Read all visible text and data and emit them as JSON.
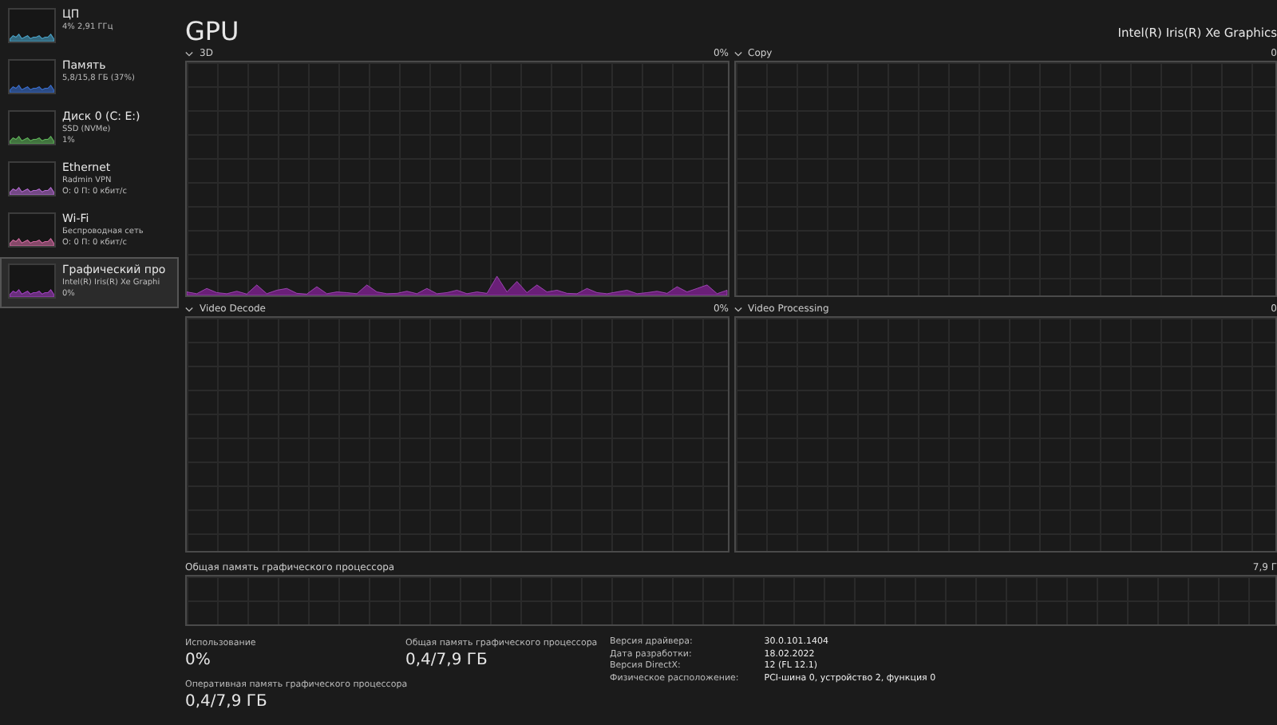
{
  "sidebar": {
    "items": [
      {
        "title": "ЦП",
        "line_1": "4% 2,91 ГГц",
        "color": "#4aa3c8",
        "selected": false
      },
      {
        "title": "Память",
        "line_1": "5,8/15,8 ГБ (37%)",
        "color": "#3a6fd0",
        "selected": false
      },
      {
        "title": "Диск 0 (C: E:)",
        "line_1": "SSD (NVMe)",
        "line_2": "1%",
        "color": "#5fb35a",
        "selected": false
      },
      {
        "title": "Ethernet",
        "line_1": "Radmin VPN",
        "line_2": "О: 0 П: 0 кбит/с",
        "color": "#b36ad0",
        "selected": false
      },
      {
        "title": "Wi-Fi",
        "line_1": "Беспроводная сеть",
        "line_2": "О: 0 П: 0 кбит/с",
        "color": "#d06aa0",
        "selected": false
      },
      {
        "title": "Графический про",
        "line_1": "Intel(R) Iris(R) Xe Graphi",
        "line_2": "0%",
        "color": "#a040c0",
        "selected": true
      }
    ]
  },
  "header": {
    "title": "GPU",
    "device": "Intel(R) Iris(R) Xe Graphics"
  },
  "engines": [
    {
      "name": "3D",
      "value": "0%",
      "activity": true
    },
    {
      "name": "Copy",
      "value": "0",
      "activity": false
    },
    {
      "name": "Video Decode",
      "value": "0%",
      "activity": false
    },
    {
      "name": "Video Processing",
      "value": "0",
      "activity": false
    }
  ],
  "shared_memory_graph": {
    "label": "Общая память графического процессора",
    "max": "7,9 Г"
  },
  "stats": [
    {
      "label": "Использование",
      "value": "0%"
    },
    {
      "label": "Оперативная память графического процессора",
      "value": "0,4/7,9 ГБ"
    },
    {
      "label": "Общая память графического процессора",
      "value": "0,4/7,9 ГБ"
    }
  ],
  "details": [
    {
      "key": "Версия драйвера:",
      "value": "30.0.101.1404"
    },
    {
      "key": "Дата разработки:",
      "value": "18.02.2022"
    },
    {
      "key": "Версия DirectX:",
      "value": "12 (FL 12.1)"
    },
    {
      "key": "Физическое расположение:",
      "value": "PCI-шина 0, устройство 2, функция 0"
    }
  ]
}
